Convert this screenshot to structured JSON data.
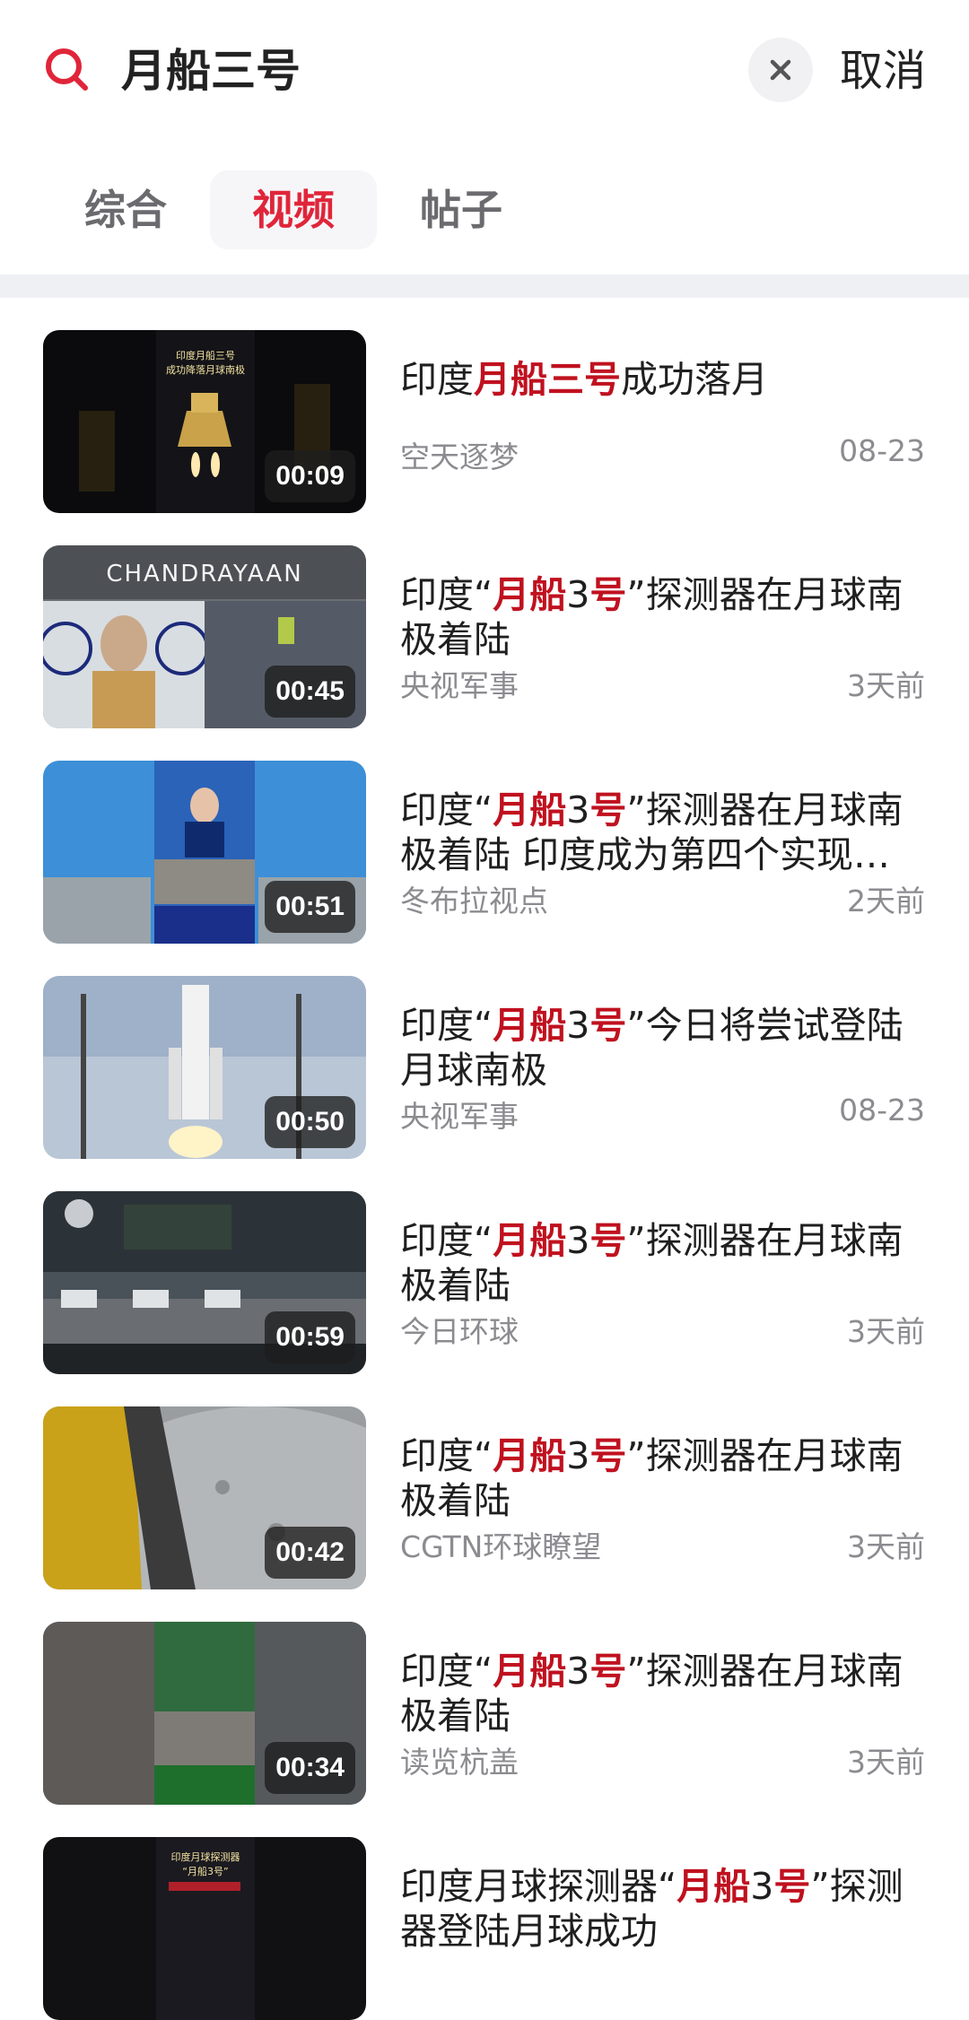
{
  "search": {
    "query": "月船三号",
    "cancel_label": "取消"
  },
  "tabs": [
    {
      "label": "综合",
      "active": false
    },
    {
      "label": "视频",
      "active": true
    },
    {
      "label": "帖子",
      "active": false
    }
  ],
  "colors": {
    "accent": "#e0253a",
    "highlight": "#c0111f",
    "meta_gray": "#8b8b90",
    "divider": "#eef0f4"
  },
  "videos": [
    {
      "title_parts": [
        {
          "t": "印度"
        },
        {
          "t": "月船三号",
          "hl": true
        },
        {
          "t": "成功落月"
        }
      ],
      "author": "空天逐梦",
      "date": "08-23",
      "duration": "00:09",
      "thumb_text": [
        "印度月船三号",
        "成功降落月球南极"
      ]
    },
    {
      "title_parts": [
        {
          "t": "印度“"
        },
        {
          "t": "月船",
          "hl": true
        },
        {
          "t": "3"
        },
        {
          "t": "号",
          "hl": true
        },
        {
          "t": "”探测器在月球南极着陆"
        }
      ],
      "author": "央视军事",
      "date": "3天前",
      "duration": "00:45",
      "thumb_text": [
        "CHANDRAYAAN"
      ]
    },
    {
      "title_parts": [
        {
          "t": "印度“"
        },
        {
          "t": "月船",
          "hl": true
        },
        {
          "t": "3"
        },
        {
          "t": "号",
          "hl": true
        },
        {
          "t": "”探测器在月球南极着陆 印度成为第四个实现…"
        }
      ],
      "author": "冬布拉视点",
      "date": "2天前",
      "duration": "00:51",
      "thumb_text": []
    },
    {
      "title_parts": [
        {
          "t": "印度“"
        },
        {
          "t": "月船",
          "hl": true
        },
        {
          "t": "3"
        },
        {
          "t": "号",
          "hl": true
        },
        {
          "t": "”今日将尝试登陆月球南极"
        }
      ],
      "author": "央视军事",
      "date": "08-23",
      "duration": "00:50",
      "thumb_text": []
    },
    {
      "title_parts": [
        {
          "t": "印度“"
        },
        {
          "t": "月船",
          "hl": true
        },
        {
          "t": "3"
        },
        {
          "t": "号",
          "hl": true
        },
        {
          "t": "”探测器在月球南极着陆"
        }
      ],
      "author": "今日环球",
      "date": "3天前",
      "duration": "00:59",
      "thumb_text": []
    },
    {
      "title_parts": [
        {
          "t": "印度“"
        },
        {
          "t": "月船",
          "hl": true
        },
        {
          "t": "3"
        },
        {
          "t": "号",
          "hl": true
        },
        {
          "t": "”探测器在月球南极着陆"
        }
      ],
      "author": "CGTN环球瞭望",
      "date": "3天前",
      "duration": "00:42",
      "thumb_text": []
    },
    {
      "title_parts": [
        {
          "t": "印度“"
        },
        {
          "t": "月船",
          "hl": true
        },
        {
          "t": "3"
        },
        {
          "t": "号",
          "hl": true
        },
        {
          "t": "”探测器在月球南极着陆"
        }
      ],
      "author": "读览杭盖",
      "date": "3天前",
      "duration": "00:34",
      "thumb_text": []
    },
    {
      "title_parts": [
        {
          "t": "印度月球探测器“"
        },
        {
          "t": "月船",
          "hl": true
        },
        {
          "t": "3"
        },
        {
          "t": "号",
          "hl": true
        },
        {
          "t": "”探测器登陆月球成功"
        }
      ],
      "author": "",
      "date": "",
      "duration": "",
      "thumb_text": [
        "印度月球探测器",
        "“月船3号”"
      ]
    }
  ]
}
